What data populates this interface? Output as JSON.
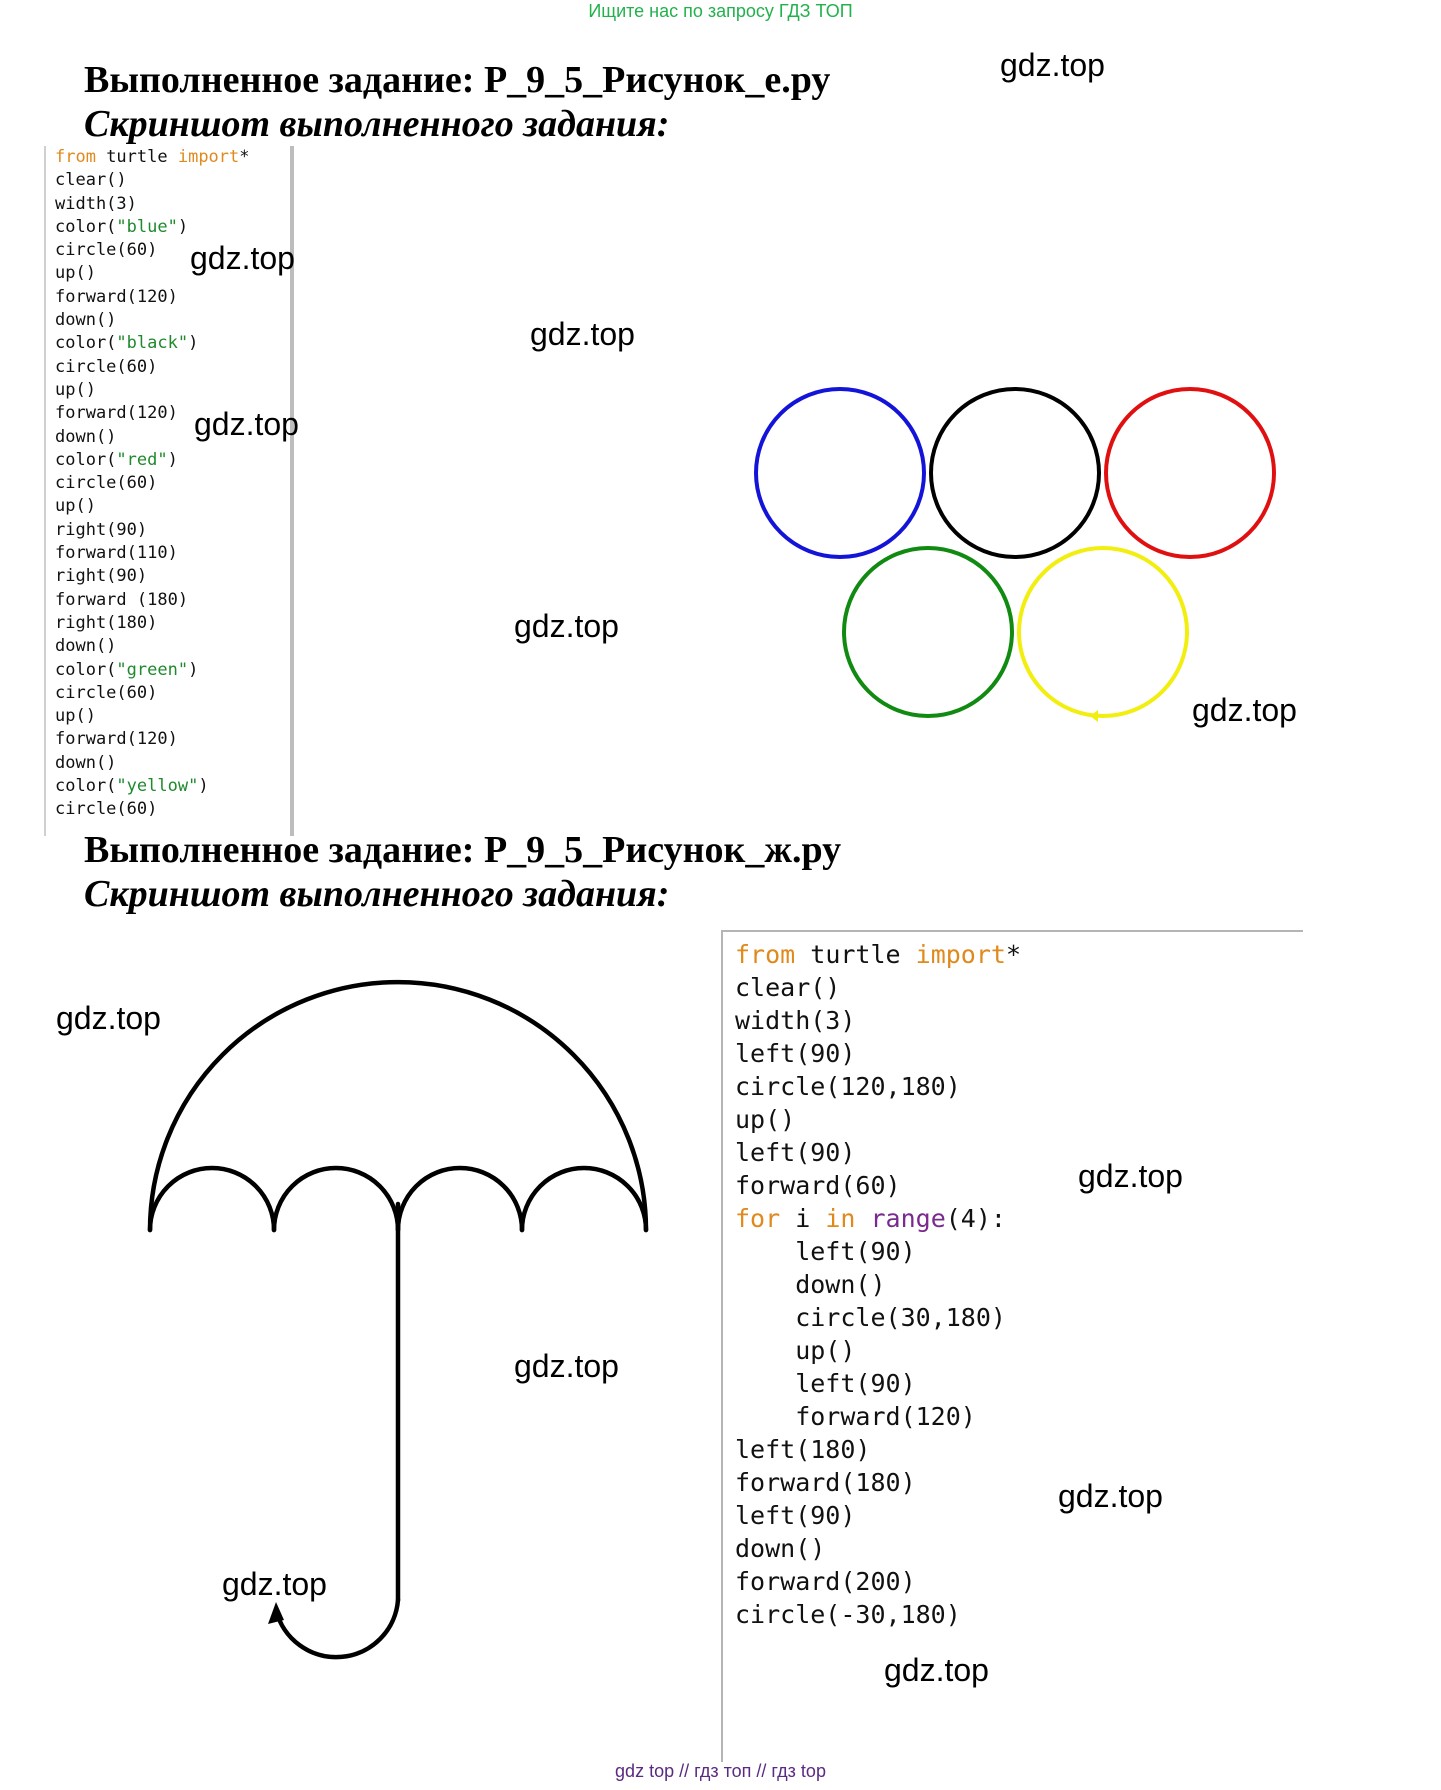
{
  "top_link": "Ищите нас по запросу ГДЗ ТОП",
  "section1": {
    "title": "Выполненное задание: Р_9_5_Рисунок_е.ру",
    "subtitle": "Скриншот выполненного задания:",
    "code": [
      [
        {
          "t": "from",
          "c": "kw"
        },
        {
          "t": " turtle "
        },
        {
          "t": "import",
          "c": "kw"
        },
        {
          "t": "*"
        }
      ],
      [
        {
          "t": "clear()"
        }
      ],
      [
        {
          "t": "width(3)"
        }
      ],
      [
        {
          "t": "color("
        },
        {
          "t": "\"blue\"",
          "c": "str"
        },
        {
          "t": ")"
        }
      ],
      [
        {
          "t": "circle(60)"
        }
      ],
      [
        {
          "t": "up()"
        }
      ],
      [
        {
          "t": "forward(120)"
        }
      ],
      [
        {
          "t": "down()"
        }
      ],
      [
        {
          "t": "color("
        },
        {
          "t": "\"black\"",
          "c": "str"
        },
        {
          "t": ")"
        }
      ],
      [
        {
          "t": "circle(60)"
        }
      ],
      [
        {
          "t": "up()"
        }
      ],
      [
        {
          "t": "forward(120)"
        }
      ],
      [
        {
          "t": "down()"
        }
      ],
      [
        {
          "t": "color("
        },
        {
          "t": "\"red\"",
          "c": "str"
        },
        {
          "t": ")"
        }
      ],
      [
        {
          "t": "circle(60)"
        }
      ],
      [
        {
          "t": "up()"
        }
      ],
      [
        {
          "t": "right(90)"
        }
      ],
      [
        {
          "t": "forward(110)"
        }
      ],
      [
        {
          "t": "right(90)"
        }
      ],
      [
        {
          "t": "forward (180)"
        }
      ],
      [
        {
          "t": "right(180)"
        }
      ],
      [
        {
          "t": "down()"
        }
      ],
      [
        {
          "t": "color("
        },
        {
          "t": "\"green\"",
          "c": "str"
        },
        {
          "t": ")"
        }
      ],
      [
        {
          "t": "circle(60)"
        }
      ],
      [
        {
          "t": "up()"
        }
      ],
      [
        {
          "t": "forward(120)"
        }
      ],
      [
        {
          "t": "down()"
        }
      ],
      [
        {
          "t": "color("
        },
        {
          "t": "\"yellow\"",
          "c": "str"
        },
        {
          "t": ")"
        }
      ],
      [
        {
          "t": "circle(60)"
        }
      ]
    ],
    "ring_colors": [
      "#1414d8",
      "#000000",
      "#e01010",
      "#118a11",
      "#f2ee10"
    ]
  },
  "section2": {
    "title": "Выполненное задание: Р_9_5_Рисунок_ж.ру",
    "subtitle": "Скриншот выполненного задания:",
    "code": [
      [
        {
          "t": "from",
          "c": "kw"
        },
        {
          "t": " turtle "
        },
        {
          "t": "import",
          "c": "kw"
        },
        {
          "t": "*"
        }
      ],
      [
        {
          "t": "clear()"
        }
      ],
      [
        {
          "t": "width(3)"
        }
      ],
      [
        {
          "t": "left(90)"
        }
      ],
      [
        {
          "t": "circle(120,180)"
        }
      ],
      [
        {
          "t": "up()"
        }
      ],
      [
        {
          "t": "left(90)"
        }
      ],
      [
        {
          "t": "forward(60)"
        }
      ],
      [
        {
          "t": "for",
          "c": "kw"
        },
        {
          "t": " i "
        },
        {
          "t": "in",
          "c": "kw"
        },
        {
          "t": " "
        },
        {
          "t": "range",
          "c": "fn"
        },
        {
          "t": "(4):"
        }
      ],
      [
        {
          "t": "    left(90)"
        }
      ],
      [
        {
          "t": "    down()"
        }
      ],
      [
        {
          "t": "    circle(30,180)"
        }
      ],
      [
        {
          "t": "    up()"
        }
      ],
      [
        {
          "t": "    left(90)"
        }
      ],
      [
        {
          "t": "    forward(120)"
        }
      ],
      [
        {
          "t": "left(180)"
        }
      ],
      [
        {
          "t": "forward(180)"
        }
      ],
      [
        {
          "t": "left(90)"
        }
      ],
      [
        {
          "t": "down()"
        }
      ],
      [
        {
          "t": "forward(200)"
        }
      ],
      [
        {
          "t": "circle(-30,180)"
        }
      ]
    ]
  },
  "watermarks": [
    "gdz.top",
    "gdz.top",
    "gdz.top",
    "gdz.top",
    "gdz.top",
    "gdz.top",
    "gdz.top",
    "gdz.top",
    "gdz.top",
    "gdz.top",
    "gdz.top",
    "gdz.top"
  ],
  "footer": "gdz top // гдз топ // гдз top"
}
